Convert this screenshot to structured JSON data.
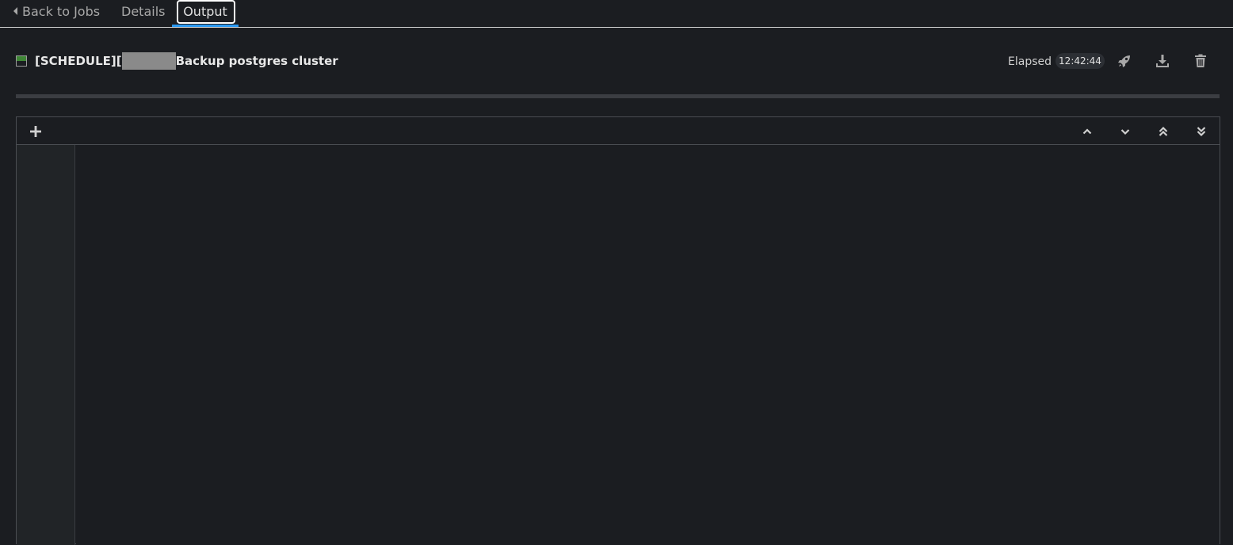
{
  "tabs": {
    "back_label": "Back to Jobs",
    "details_label": "Details",
    "output_label": "Output"
  },
  "header": {
    "title_prefix": "[SCHEDULE][",
    "title_suffix": "Backup postgres cluster",
    "elapsed_label": "Elapsed",
    "elapsed_value": "12:42:44",
    "status_color": "#3e8635"
  },
  "icons": {
    "relaunch": "rocket-icon",
    "download": "download-icon",
    "delete": "trash-icon",
    "expand": "plus-icon",
    "scroll_up": "chevron-up-icon",
    "scroll_down": "chevron-down-icon",
    "scroll_top": "double-chevron-up-icon",
    "scroll_bottom": "double-chevron-down-icon"
  },
  "colors": {
    "accent": "#2b9af3",
    "background": "#1b1d21"
  }
}
